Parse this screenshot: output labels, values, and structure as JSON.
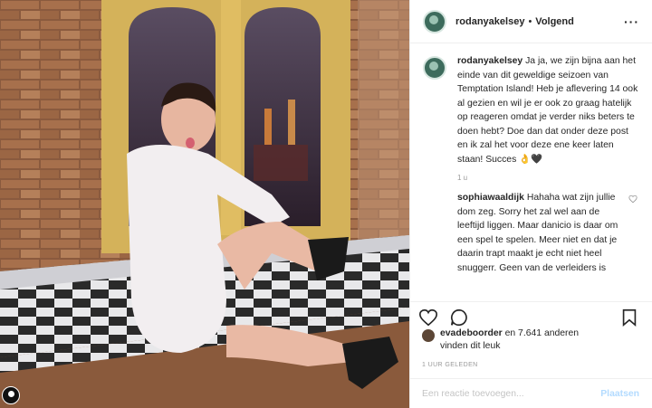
{
  "post": {
    "username": "rodanyakelsey",
    "follow_label": "Volgend",
    "separator": "•",
    "more_icon": "more-options-icon"
  },
  "comments": [
    {
      "username": "rodanyakelsey",
      "text": "Ja ja, we zijn bijna aan het einde van dit geweldige seizoen van Temptation Island! Heb je aflevering 14 ook al gezien en wil je er ook zo graag hatelijk op reageren omdat je verder niks beters te doen hebt? Doe dan dat onder deze post en ik zal het voor deze ene keer laten staan! Succes 👌🖤",
      "time": "1 u"
    },
    {
      "username": "sophiawaaldijk",
      "text": "Hahaha wat zijn jullie dom zeg. Sorry het zal wel aan de leeftijd liggen. Maar danicio is daar om een spel te spelen. Meer niet en dat je daarin trapt maakt je echt niet heel snuggerr. Geen van de verleiders is"
    }
  ],
  "likes": {
    "first_user": "evadeboorder",
    "rest": " en 7.641 anderen",
    "line2": "vinden dit leuk"
  },
  "time_ago": "1 UUR GELEDEN",
  "comment_box": {
    "placeholder": "Een reactie toevoegen...",
    "post_label": "Plaatsen"
  }
}
